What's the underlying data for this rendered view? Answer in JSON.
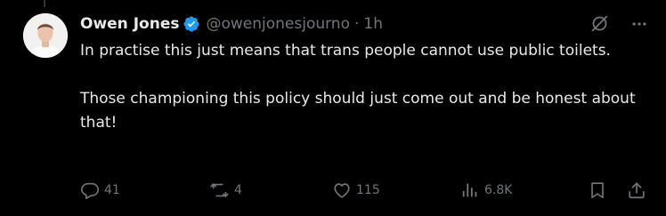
{
  "author": {
    "display_name": "Owen Jones",
    "handle": "@owenjonesjourno",
    "separator": "·",
    "time": "1h",
    "verified": true
  },
  "tweet": {
    "paragraphs": [
      "In practise this just means that trans people cannot use public toilets.",
      "Those championing this policy should just come out and be honest about that!"
    ]
  },
  "actions": {
    "reply_count": "41",
    "retweet_count": "4",
    "like_count": "115",
    "views_count": "6.8K"
  },
  "icons": {
    "verified": "verified-badge-icon",
    "grok": "grok-icon",
    "more": "more-options-icon",
    "reply": "reply-icon",
    "retweet": "retweet-icon",
    "like": "heart-icon",
    "views": "views-icon",
    "bookmark": "bookmark-icon",
    "share": "share-icon"
  },
  "colors": {
    "background": "#000000",
    "primary_text": "#e7e9ea",
    "secondary_text": "#71767b",
    "verified_blue": "#1d9bf0"
  }
}
